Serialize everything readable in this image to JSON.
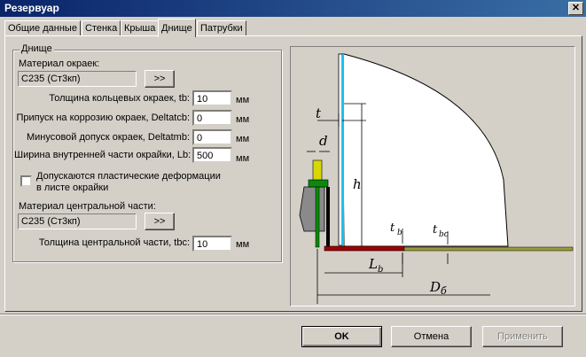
{
  "window": {
    "title": "Резервуар",
    "close_glyph": "✕"
  },
  "tabs": [
    "Общие данные",
    "Стенка",
    "Крыша",
    "Днище",
    "Патрубки"
  ],
  "active_tab": "Днище",
  "group": {
    "legend": "Днище",
    "edge_material": {
      "label": "Материал окраек:",
      "value": "С235 (Ст3кп)",
      "button": ">>"
    },
    "fields": [
      {
        "label": "Толщина кольцевых окраек, tb:",
        "value": "10",
        "unit": "мм"
      },
      {
        "label": "Припуск на коррозию окраек, Deltatcb:",
        "value": "0",
        "unit": "мм"
      },
      {
        "label": "Минусовой допуск окраек, Deltatmb:",
        "value": "0",
        "unit": "мм"
      },
      {
        "label": "Ширина внутренней части окрайки, Lb:",
        "value": "500",
        "unit": "мм"
      }
    ],
    "plastic": {
      "line1": "Допускаются пластические деформации",
      "line2": "в листе окрайки",
      "checked": false
    },
    "center_material": {
      "label": "Материал центральной части:",
      "value": "С235 (Ст3кп)",
      "button": ">>"
    },
    "center_thickness": {
      "label": "Толщина центральной части, tbc:",
      "value": "10",
      "unit": "мм"
    }
  },
  "diagram": {
    "labels": {
      "t": "t",
      "d": "d",
      "h": "h",
      "tb": "t",
      "tb_sub": "b",
      "tbc": "t",
      "tbc_sub": "bc",
      "Lb": "L",
      "Lb_sub": "b",
      "D": "D",
      "D_sub": "б"
    },
    "colors": {
      "wall_edge": "#00c8ff",
      "bottom_edge": "#a00000",
      "center_plate": "#9a9a3a",
      "bolt": "#0a8a0a",
      "nut": "#d8d800"
    }
  },
  "buttons": {
    "ok": "OK",
    "cancel": "Отмена",
    "apply": "Применить"
  }
}
